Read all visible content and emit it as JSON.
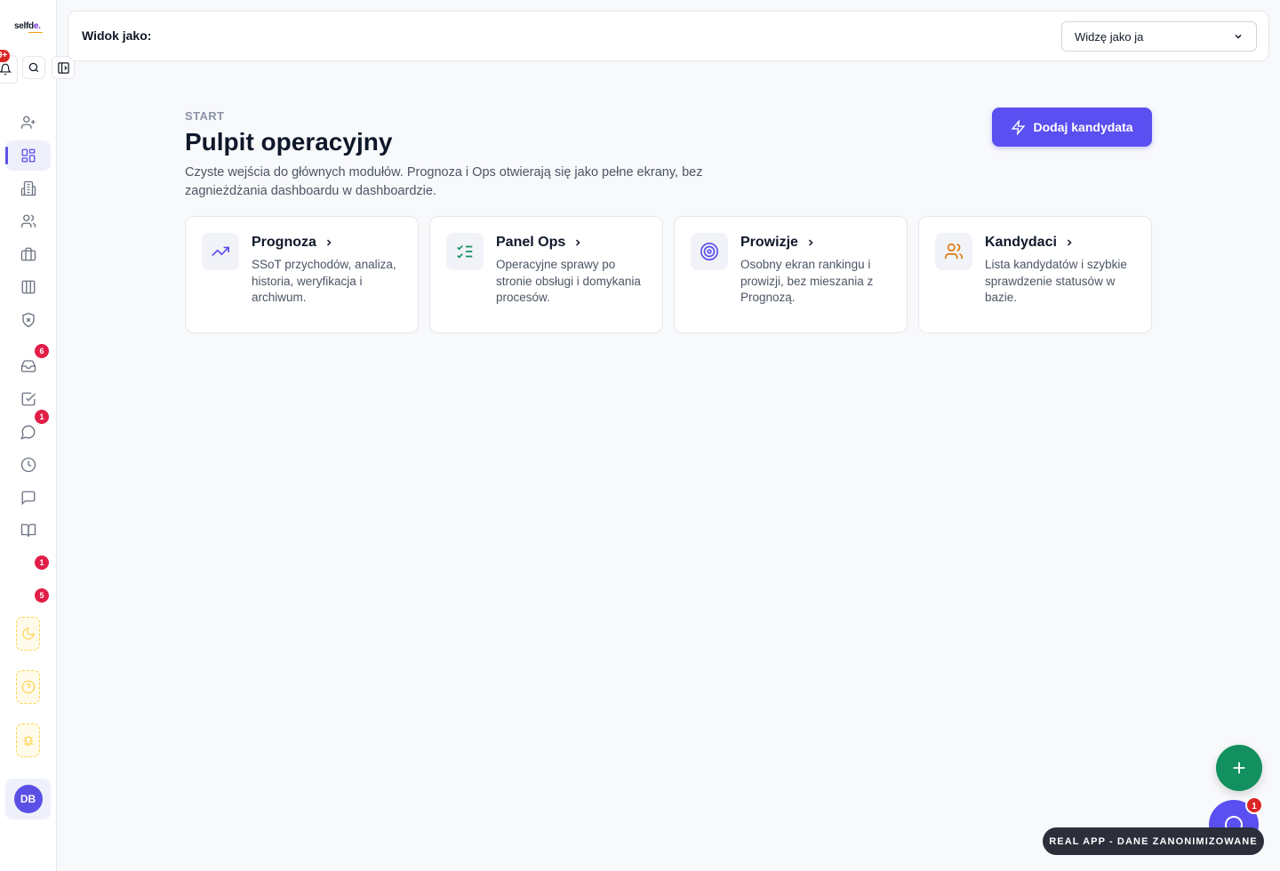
{
  "sidebar": {
    "logo": {
      "main": "selfd",
      "accent": "e."
    },
    "bell_badge": "9+",
    "badges": {
      "inbox": "6",
      "messages": "1",
      "item_13": "1",
      "item_14": "5"
    },
    "avatar_initials": "DB"
  },
  "topbar": {
    "label": "Widok jako:",
    "select_value": "Widzę jako ja"
  },
  "header": {
    "eyebrow": "START",
    "title": "Pulpit operacyjny",
    "description": "Czyste wejścia do głównych modułów. Prognoza i Ops otwierają się jako pełne ekrany, bez zagnieżdżania dashboardu w dashboardzie.",
    "add_button": "Dodaj kandydata"
  },
  "cards": [
    {
      "title": "Prognoza",
      "description": "SSoT przychodów, analiza, historia, weryfikacja i archiwum.",
      "icon": "trending-up-icon",
      "color": "#5a4ff0"
    },
    {
      "title": "Panel Ops",
      "description": "Operacyjne sprawy po stronie obsługi i domykania procesów.",
      "icon": "list-checks-icon",
      "color": "#12905f"
    },
    {
      "title": "Prowizje",
      "description": "Osobny ekran rankingu i prowizji, bez mieszania z Prognozą.",
      "icon": "target-icon",
      "color": "#5a4ff0"
    },
    {
      "title": "Kandydaci",
      "description": "Lista kandydatów i szybkie sprawdzenie statusów w bazie.",
      "icon": "users-icon",
      "color": "#d97706"
    }
  ],
  "fab": {
    "chat_badge": "1"
  },
  "banner": "REAL APP - DANE ZANONIMIZOWANE",
  "colors": {
    "accent": "#5a4ff0",
    "success": "#12905f",
    "badge": "#dc2626",
    "warning": "#d97706"
  }
}
